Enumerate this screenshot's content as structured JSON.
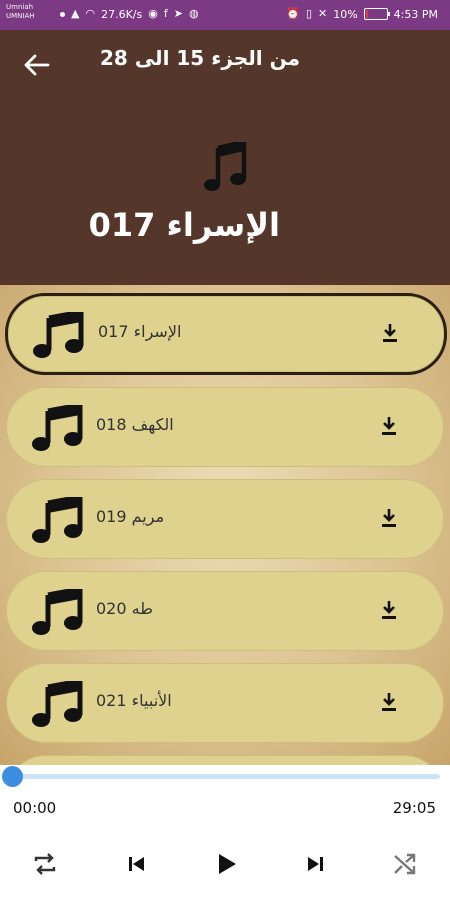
{
  "status_bar": {
    "carrier_lines": [
      "Umniah",
      "UMNIAH"
    ],
    "network_speed": "27.6K/s",
    "battery_percent": "10%",
    "time": "4:53 PM",
    "battery_level": 0.1
  },
  "header": {
    "title": "من الجزء 15 الى 28",
    "now_playing": "الإسراء 017"
  },
  "tracks": [
    {
      "label": "الإسراء 017",
      "active": true
    },
    {
      "label": "الكهف 018",
      "active": false
    },
    {
      "label": "مريم 019",
      "active": false
    },
    {
      "label": "طه 020",
      "active": false
    },
    {
      "label": "الأنبياء 021",
      "active": false
    }
  ],
  "player": {
    "current_time": "00:00",
    "total_time": "29:05",
    "progress": 0
  },
  "colors": {
    "status_bar": "#7b3a83",
    "header": "#54362a",
    "item_bg": "#ded28e",
    "accent": "#3d8de0"
  },
  "icons": [
    "back-arrow-icon",
    "music-note-icon",
    "download-icon",
    "repeat-icon",
    "previous-icon",
    "play-icon",
    "next-icon",
    "shuffle-icon"
  ]
}
